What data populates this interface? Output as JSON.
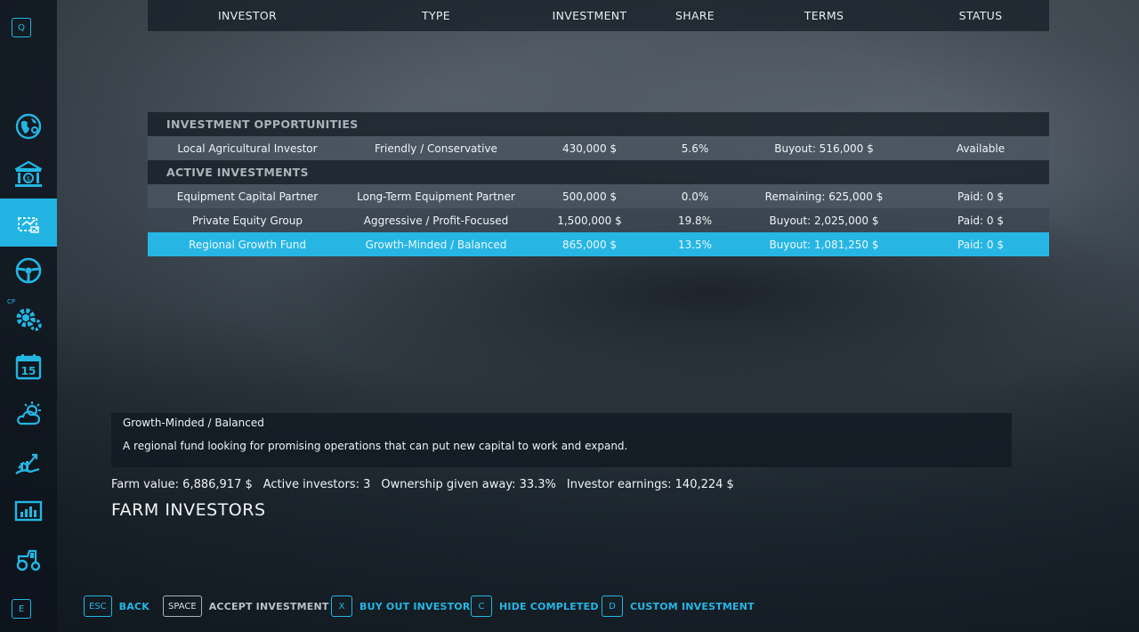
{
  "sidebar": {
    "top_key": "Q",
    "bottom_key": "E",
    "cp_label": "CP",
    "items": [
      {
        "icon": "globe-map-icon"
      },
      {
        "icon": "bank-finance-icon"
      },
      {
        "icon": "investors-icon",
        "active": true
      },
      {
        "icon": "steering-wheel-icon"
      },
      {
        "icon": "gear-production-icon"
      },
      {
        "icon": "calendar-icon",
        "value": "15"
      },
      {
        "icon": "weather-icon"
      },
      {
        "icon": "growth-hand-icon"
      },
      {
        "icon": "statistics-icon"
      },
      {
        "icon": "tractor-icon"
      }
    ]
  },
  "table": {
    "headers": [
      "INVESTOR",
      "TYPE",
      "INVESTMENT",
      "SHARE",
      "TERMS",
      "STATUS"
    ],
    "sections": [
      {
        "title": "INVESTMENT OPPORTUNITIES",
        "rows": [
          {
            "investor": "Local Agricultural Investor",
            "type": "Friendly / Conservative",
            "investment": "430,000 $",
            "share": "5.6%",
            "terms": "Buyout: 516,000 $",
            "status": "Available"
          }
        ]
      },
      {
        "title": "ACTIVE INVESTMENTS",
        "rows": [
          {
            "investor": "Equipment Capital Partner",
            "type": "Long-Term Equipment Partner",
            "investment": "500,000 $",
            "share": "0.0%",
            "terms": "Remaining: 625,000 $",
            "status": "Paid: 0 $"
          },
          {
            "investor": "Private Equity Group",
            "type": "Aggressive / Profit-Focused",
            "investment": "1,500,000 $",
            "share": "19.8%",
            "terms": "Buyout: 2,025,000 $",
            "status": "Paid: 0 $"
          },
          {
            "investor": "Regional Growth Fund",
            "type": "Growth-Minded / Balanced",
            "investment": "865,000 $",
            "share": "13.5%",
            "terms": "Buyout: 1,081,250 $",
            "status": "Paid: 0 $",
            "selected": true
          }
        ]
      }
    ]
  },
  "description": {
    "title": "Growth-Minded / Balanced",
    "text": "A regional fund looking for promising operations that can put new capital to work and expand."
  },
  "stats": {
    "farm_value": "Farm value: 6,886,917 $",
    "active_investors": "Active investors: 3",
    "ownership": "Ownership given away: 33.3%",
    "earnings": "Investor earnings: 140,224 $"
  },
  "page_title": "FARM INVESTORS",
  "hints": [
    {
      "key": "ESC",
      "label": "BACK"
    },
    {
      "key": "SPACE",
      "label": "ACCEPT INVESTMENT",
      "disabled": true
    },
    {
      "key": "X",
      "label": "BUY OUT INVESTOR"
    },
    {
      "key": "C",
      "label": "HIDE COMPLETED"
    },
    {
      "key": "D",
      "label": "CUSTOM INVESTMENT"
    }
  ],
  "colors": {
    "accent": "#24b6e3",
    "selected_row": "#27b6e4"
  }
}
